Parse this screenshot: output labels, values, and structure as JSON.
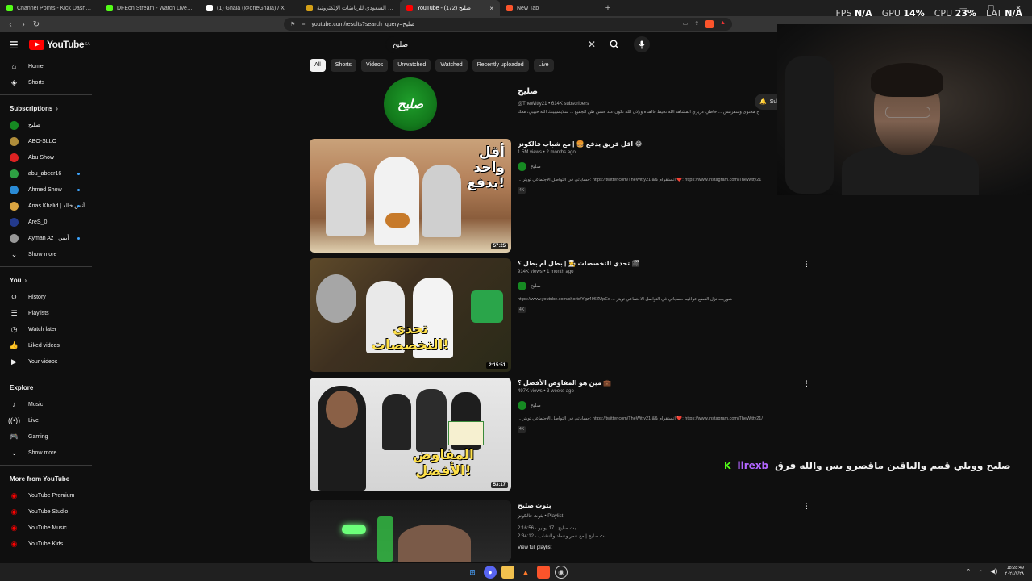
{
  "browser": {
    "tabs": [
      {
        "title": "Channel Points - Kick Dashboard",
        "color": "#53fc18",
        "active": false
      },
      {
        "title": "DFEon Stream - Watch Live on Kick",
        "color": "#53fc18",
        "active": false
      },
      {
        "title": "(1) Ghala (@oneGhala) / X",
        "color": "#ffffff",
        "active": false
      },
      {
        "title": "جوائز الاتحاد السعودي للرياضات الإلكترونية",
        "color": "#d4a017",
        "active": false
      },
      {
        "title": "YouTube - صليح (172)",
        "color": "#ff0000",
        "active": true
      },
      {
        "title": "New Tab",
        "color": "#fb542b",
        "active": false
      }
    ],
    "new_tab": "+",
    "close_tab": "×",
    "url": "youtube.com/results?search_query=صليح"
  },
  "stats": {
    "fps_label": "FPS",
    "fps_value": "N/A",
    "gpu_label": "GPU",
    "gpu_value": "14%",
    "cpu_label": "CPU",
    "cpu_value": "23%",
    "lat_label": "LAT",
    "lat_value": "N/A"
  },
  "youtube": {
    "logo_text": "YouTube",
    "logo_country": "SA",
    "search_value": "صليح"
  },
  "sidebar": {
    "main": [
      {
        "label": "Home",
        "icon": "home-icon",
        "glyph": "⌂"
      },
      {
        "label": "Shorts",
        "icon": "shorts-icon",
        "glyph": "◈"
      }
    ],
    "subscriptions_title": "Subscriptions",
    "subscriptions": [
      {
        "label": "صليح",
        "color": "#168a22",
        "dot": false
      },
      {
        "label": "ABO-SLLO",
        "color": "#b08d3a",
        "dot": false
      },
      {
        "label": "Abu Show",
        "color": "#d22",
        "dot": false
      },
      {
        "label": "abu_abeer16",
        "color": "#2ea043",
        "dot": true
      },
      {
        "label": "Ahmed Show",
        "color": "#2a8bd6",
        "dot": true
      },
      {
        "label": "Anas Khalid | أنس خالد",
        "color": "#d9a441",
        "dot": true
      },
      {
        "label": "AreS_0",
        "color": "#233a8c",
        "dot": false
      },
      {
        "label": "Ayman Az | أيمن",
        "color": "#999999",
        "dot": true
      }
    ],
    "show_more_1": "Show more",
    "you_title": "You",
    "you": [
      {
        "label": "History",
        "icon": "history-icon",
        "glyph": "↺"
      },
      {
        "label": "Playlists",
        "icon": "playlists-icon",
        "glyph": "☰"
      },
      {
        "label": "Watch later",
        "icon": "watch-later-icon",
        "glyph": "◷"
      },
      {
        "label": "Liked videos",
        "icon": "like-icon",
        "glyph": "👍"
      },
      {
        "label": "Your videos",
        "icon": "your-videos-icon",
        "glyph": "▶"
      }
    ],
    "explore_title": "Explore",
    "explore": [
      {
        "label": "Music",
        "icon": "music-icon",
        "glyph": "♪"
      },
      {
        "label": "Live",
        "icon": "live-icon",
        "glyph": "((•))"
      },
      {
        "label": "Gaming",
        "icon": "gaming-icon",
        "glyph": "🎮"
      }
    ],
    "show_more_2": "Show more",
    "more_title": "More from YouTube",
    "more": [
      {
        "label": "YouTube Premium"
      },
      {
        "label": "YouTube Studio"
      },
      {
        "label": "YouTube Music"
      },
      {
        "label": "YouTube Kids"
      }
    ]
  },
  "chips": [
    "All",
    "Shorts",
    "Videos",
    "Unwatched",
    "Watched",
    "Recently uploaded",
    "Live"
  ],
  "channel": {
    "name": "صليح",
    "handle_subs": "@TheWitty21 • 614K subscribers",
    "description": "صليح محتوى وسفرمس ... حاطي عزيزي المشاهد الله نحيط فالقناة وبإذن الله تكون عند حسن ظن الجميع ... سلايسيبيتك الله حبيبي، معك",
    "avatar_text": "صليح",
    "subscribe_label": "Sub"
  },
  "videos": [
    {
      "title": "اقل فريق يدفع 🍔 | مع شباب فالكونز 😂",
      "meta": "1.5M views • 2 months ago",
      "channel": "صليح",
      "description": "... حساباتي في التواصل الاجتماعي تويتر: https://twitter.com/TheWitty21 && انستقرام ❤️: https://www.instagram.com/TheWitty21",
      "badge": "4K",
      "duration": "57:25",
      "thumb_text": "أقل واحد يدفع!"
    },
    {
      "title": "تحدي التخصصات 👨‍🍳 | بطل أم بطل ؟ 🎬",
      "meta": "914K views • 1 month ago",
      "channel": "صليح",
      "description": "https://www.youtube.com/shorts/Ygz496ZUpEs ... شوربت نزل القطع عوافيه حساباتي في التواصل الاجتماعي تويتر",
      "badge": "4K",
      "duration": "2:15:51",
      "thumb_text": "تحدي التخصصات!"
    },
    {
      "title": "مين هو المفاوض الأفضل ؟ 💼",
      "meta": "497K views • 3 weeks ago",
      "channel": "صليح",
      "description": "... حساباتي في التواصل الاجتماعي تويتر: https://twitter.com/TheWitty21 && انستقرام ❤️: https://www.instagram.com/TheWitty21/",
      "badge": "4K",
      "duration": "53:17",
      "thumb_text": "المفاوض الأفضل!"
    }
  ],
  "playlist": {
    "title": "بثوث صليح",
    "meta": "بثوث فالكونز • Playlist",
    "item1": "بث صليح | 17 يوليو · 2:16:56",
    "item2": "بث صليح | مع عمر وعماد والنشاب · 2:34:12",
    "view_full": "View full playlist"
  },
  "chat": {
    "platform": "K",
    "user": "llrexb",
    "message": "صليح وويلي قمم والباقين ماقصرو بس والله فرق"
  },
  "taskbar": {
    "time": "18:28:49",
    "date": "٢٠٢٤/٧/٢٨"
  }
}
